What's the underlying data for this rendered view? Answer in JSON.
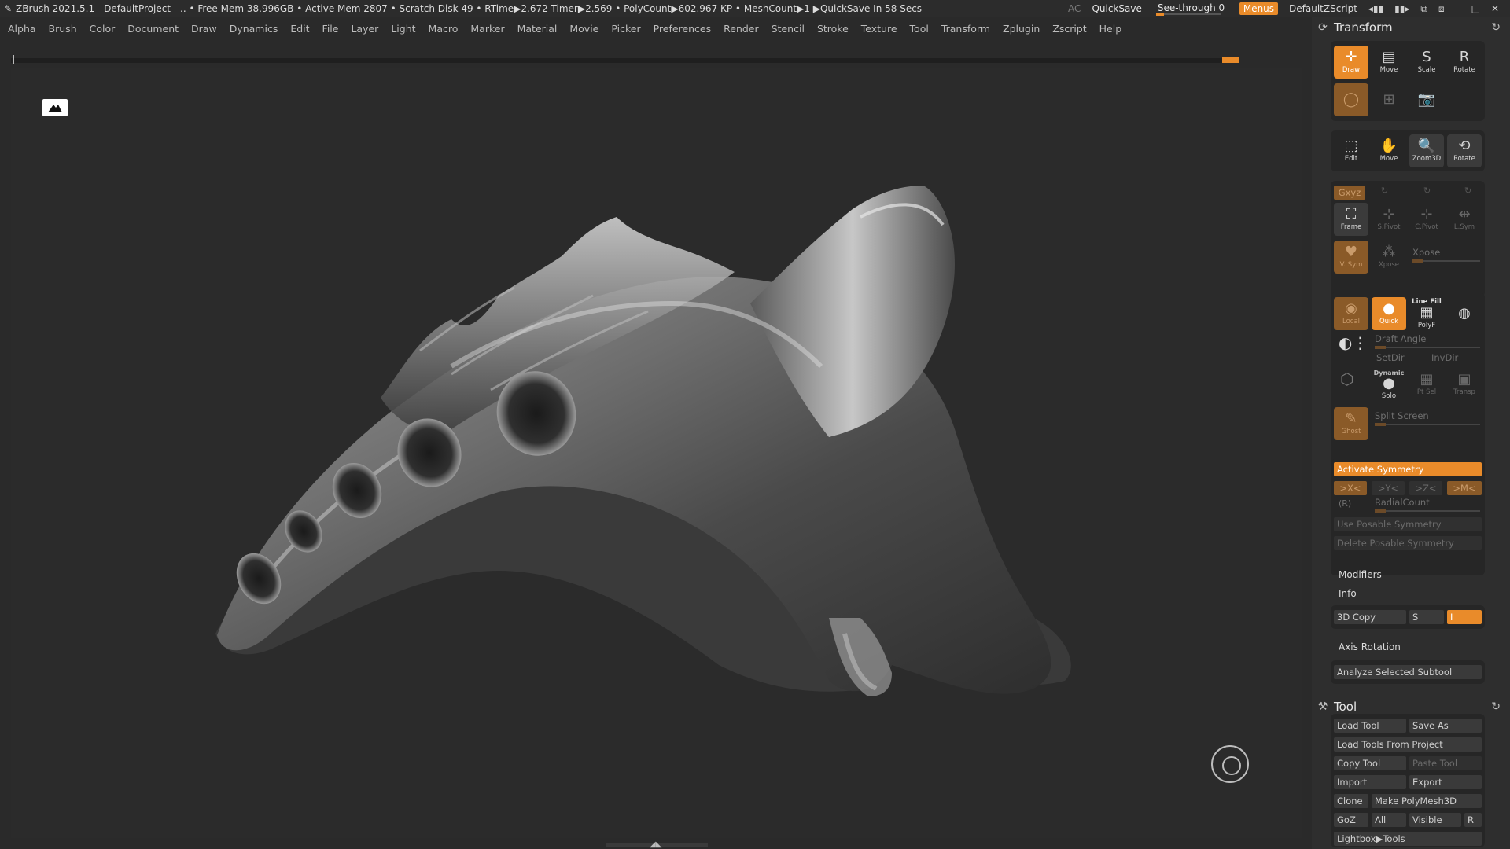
{
  "titlebar": {
    "app": "ZBrush 2021.5.1",
    "project": "DefaultProject",
    "stats": ".. • Free Mem 38.996GB • Active Mem 2807 • Scratch Disk 49 •  RTime▶2.672 Timer▶2.569 • PolyCount▶602.967 KP  • MeshCount▶1  ▶QuickSave In 58 Secs",
    "ac": "AC",
    "quicksave": "QuickSave",
    "seethrough": "See-through   0",
    "menus": "Menus",
    "zscript": "DefaultZScript"
  },
  "menubar": {
    "items": [
      "Alpha",
      "Brush",
      "Color",
      "Document",
      "Draw",
      "Dynamics",
      "Edit",
      "File",
      "Layer",
      "Light",
      "Macro",
      "Marker",
      "Material",
      "Movie",
      "Picker",
      "Preferences",
      "Render",
      "Stencil",
      "Stroke",
      "Texture",
      "Tool",
      "Transform",
      "Zplugin",
      "Zscript",
      "Help"
    ]
  },
  "transform": {
    "title": "Transform",
    "top_buttons": [
      "Draw",
      "Move",
      "Scale",
      "Rotate"
    ],
    "nav_buttons": [
      "Edit",
      "Move",
      "Zoom3D",
      "Rotate"
    ],
    "xyz_label": "Gxyz",
    "frame": "Frame",
    "spivot": "S.Pivot",
    "cpivot": "C.Pivot",
    "lsym": "L.Sym",
    "vsym": "V. Sym",
    "xpose_btn": "Xpose",
    "xpose_slider": "Xpose",
    "local": "Local",
    "quick": "Quick",
    "linefill": "Line Fill",
    "polyf": "PolyF",
    "draft_angle": "Draft Angle",
    "setdir": "SetDir",
    "invdir": "InvDir",
    "dynamic": "Dynamic",
    "solo": "Solo",
    "ptsel": "Pt Sel",
    "transp": "Transp",
    "split_screen": "Split Screen",
    "ghost": "Ghost",
    "activate_symmetry": "Activate Symmetry",
    "axes": [
      ">X<",
      ">Y<",
      ">Z<",
      ">M<"
    ],
    "r_label": "(R)",
    "radial_count": "RadialCount",
    "use_posable": "Use Posable Symmetry",
    "delete_posable": "Delete Posable Symmetry",
    "modifiers": "Modifiers",
    "info": "Info",
    "copy3d": "3D Copy",
    "s_label": "S",
    "s_value": "I",
    "axis_rotation": "Axis Rotation",
    "analyze": "Analyze Selected Subtool"
  },
  "tool": {
    "title": "Tool",
    "load_tool": "Load Tool",
    "save_as": "Save As",
    "load_from_project": "Load Tools From Project",
    "copy_tool": "Copy Tool",
    "paste_tool": "Paste Tool",
    "import": "Import",
    "export": "Export",
    "clone": "Clone",
    "make_polymesh": "Make PolyMesh3D",
    "goz": "GoZ",
    "all": "All",
    "visible": "Visible",
    "r": "R",
    "lightbox_tools": "Lightbox▶Tools"
  },
  "colors": {
    "accent": "#e98b2a",
    "background": "#2b2b2b",
    "panel": "#2e2e2e"
  }
}
